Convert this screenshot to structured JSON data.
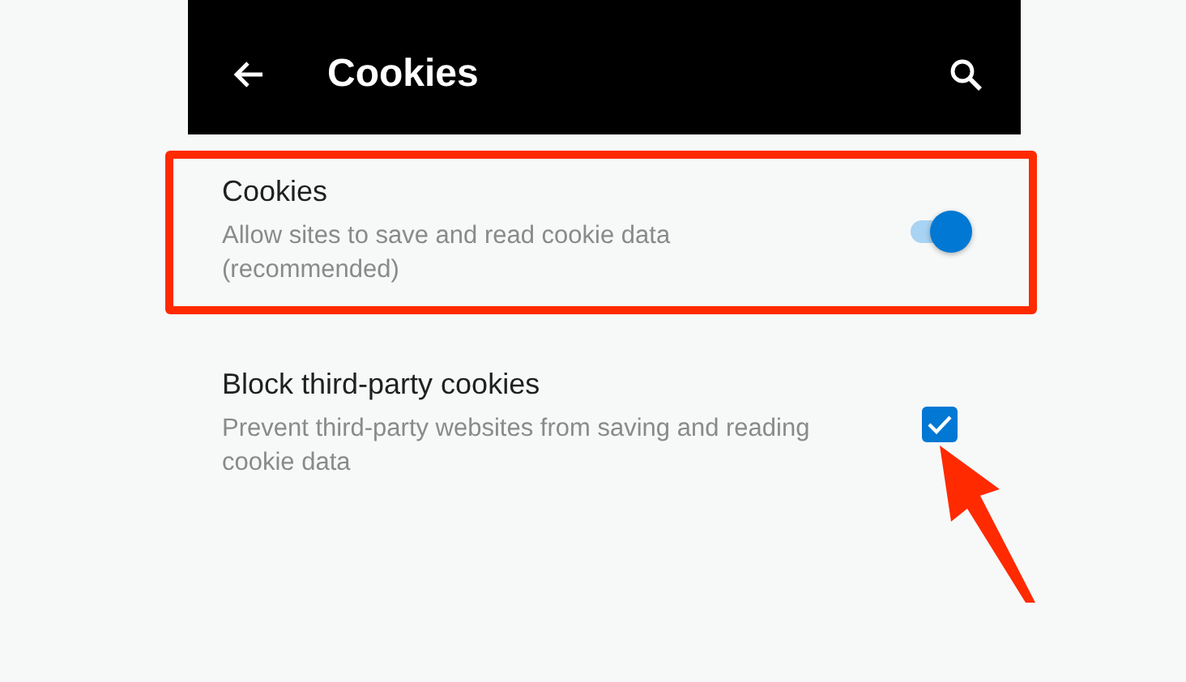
{
  "app_bar": {
    "title": "Cookies"
  },
  "settings": [
    {
      "kind": "toggle",
      "title": "Cookies",
      "description": "Allow sites to save and read cookie data (recommended)",
      "on": true,
      "highlighted": true,
      "pointed": false
    },
    {
      "kind": "checkbox",
      "title": "Block third-party cookies",
      "description": "Prevent third-party websites from saving and reading cookie data",
      "checked": true,
      "highlighted": false,
      "pointed": true
    }
  ]
}
